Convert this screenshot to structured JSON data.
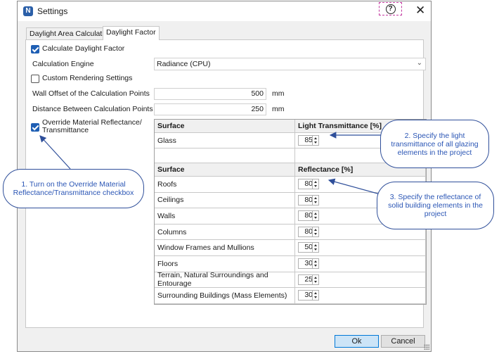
{
  "window": {
    "title": "Settings",
    "app_icon": "N"
  },
  "tabs": [
    {
      "label": "Daylight Area Calculation",
      "active": false
    },
    {
      "label": "Daylight Factor",
      "active": true
    }
  ],
  "form": {
    "calculate_daylight_factor": {
      "label": "Calculate Daylight Factor",
      "checked": true
    },
    "calculation_engine": {
      "label": "Calculation Engine",
      "value": "Radiance (CPU)"
    },
    "custom_rendering": {
      "label": "Custom Rendering Settings",
      "checked": false
    },
    "wall_offset": {
      "label": "Wall Offset of the Calculation Points",
      "value": "500",
      "unit": "mm"
    },
    "distance_between": {
      "label": "Distance Between Calculation Points",
      "value": "250",
      "unit": "mm"
    },
    "override_material": {
      "label_line1": "Override Material Reflectance/",
      "label_line2": "Transmittance",
      "checked": true
    }
  },
  "transmittance_table": {
    "col_surface": "Surface",
    "col_value": "Light Transmittance [%]",
    "rows": [
      {
        "surface": "Glass",
        "value": "85"
      }
    ]
  },
  "reflectance_table": {
    "col_surface": "Surface",
    "col_value": "Reflectance [%]",
    "rows": [
      {
        "surface": "Roofs",
        "value": "80"
      },
      {
        "surface": "Ceilings",
        "value": "80"
      },
      {
        "surface": "Walls",
        "value": "80"
      },
      {
        "surface": "Columns",
        "value": "80"
      },
      {
        "surface": "Window Frames and Mullions",
        "value": "50"
      },
      {
        "surface": "Floors",
        "value": "30"
      },
      {
        "surface": "Terrain, Natural Surroundings and Entourage",
        "value": "25"
      },
      {
        "surface": "Surrounding Buildings (Mass Elements)",
        "value": "30"
      }
    ]
  },
  "buttons": {
    "ok": "Ok",
    "cancel": "Cancel"
  },
  "callouts": {
    "c1": "1. Turn on the Override Material Reflectance/Transmittance checkbox",
    "c2": "2. Specify the light transmittance of all glazing elements in the project",
    "c3": "3. Specify the reflectance of solid building elements in the project"
  },
  "colors": {
    "accent": "#1f5fb4",
    "callout_text": "#2b56b5",
    "callout_border": "#2f4f9a"
  }
}
